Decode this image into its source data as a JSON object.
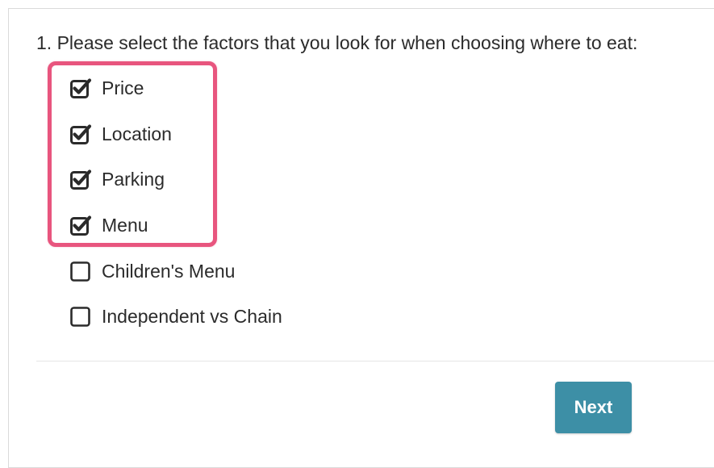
{
  "question": {
    "text": "1. Please select the factors that you look for when choosing where to eat:"
  },
  "options": [
    {
      "label": "Price",
      "checked": true,
      "icon": "checked-square-icon"
    },
    {
      "label": "Location",
      "checked": true,
      "icon": "checked-square-icon"
    },
    {
      "label": "Parking",
      "checked": true,
      "icon": "checked-square-icon"
    },
    {
      "label": "Menu",
      "checked": true,
      "icon": "checked-square-icon"
    },
    {
      "label": "Children's Menu",
      "checked": false,
      "icon": "empty-square-icon"
    },
    {
      "label": "Independent vs Chain",
      "checked": false,
      "icon": "empty-square-icon"
    }
  ],
  "actions": {
    "next_label": "Next"
  },
  "colors": {
    "highlight": "#e8557e",
    "button": "#3d8fa6",
    "text": "#2b2b2b"
  }
}
